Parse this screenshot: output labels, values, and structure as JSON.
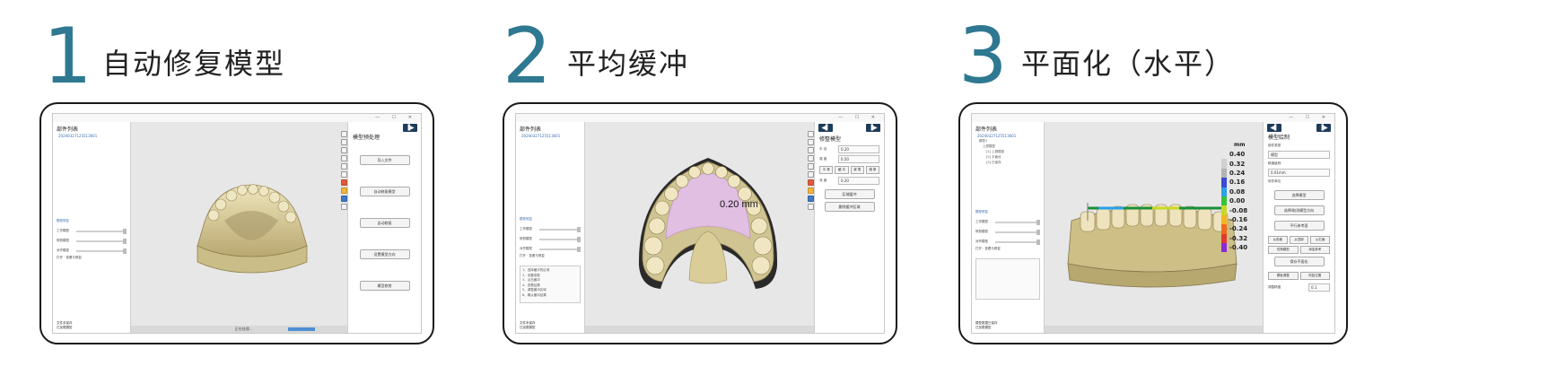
{
  "steps": [
    {
      "num": "1",
      "title": "自动修复模型"
    },
    {
      "num": "2",
      "title": "平均缓冲"
    },
    {
      "num": "3",
      "title": "平面化（水平）"
    }
  ],
  "common": {
    "window_controls": "— ☐ ✕",
    "parts_list_title": "部件列表",
    "nav_left": "◀▌",
    "nav_right": "▐▶"
  },
  "p1": {
    "file_id": "20240327125513601",
    "right_title": "模型预处理",
    "buttons": [
      "导入文件",
      "自动修复模型",
      "自动修复",
      "设置模型方向",
      "模型修剪"
    ],
    "status_text": "正在处理...",
    "foot": [
      "文件未保存",
      "已加载模型"
    ],
    "section_title": "模型修复",
    "sliders": [
      "工作模型",
      "修剪模型",
      "对齐模型"
    ],
    "section_note": "打开 · 查看与修复"
  },
  "p2": {
    "file_id": "20240327125513601",
    "right_title": "修整模型",
    "labels": [
      {
        "name": "半 径",
        "val": "0.20"
      },
      {
        "name": "强 度",
        "val": "0.50"
      }
    ],
    "seg": [
      "平 滑",
      "缓 冲",
      "减 薄",
      "增 厚"
    ],
    "depth": {
      "name": "深 度",
      "val": "0.20"
    },
    "actions": [
      "区域缓冲",
      "删除缓冲区域"
    ],
    "annotation": "0.20 mm",
    "section_title": "模型修复",
    "sliders": [
      "工作模型",
      "修剪模型",
      "对齐模型"
    ],
    "section_note": "打开 · 查看与修复",
    "notes": [
      "1、选择缓冲的区域",
      "2、设置参数",
      "3、点击缓冲",
      "4、查看结果",
      "5、调整缓冲区域",
      "6、确认缓冲结果"
    ],
    "foot": [
      "文件未保存",
      "已加载模型"
    ]
  },
  "p3": {
    "file_id": "20240327125513601",
    "tree": [
      "模型1",
      "上颌模型",
      "[1] 上颌模型",
      "[2] 平面化",
      "[3] 已保存"
    ],
    "right_title": "模型绘制",
    "labels": [
      "部件类型",
      "模型",
      "精度级别",
      "0.01mm",
      "软件单位"
    ],
    "btns": [
      "选择模型",
      "选择/取消模型方向",
      "平行参考面"
    ],
    "seg1": [
      "从前面",
      "从顶部",
      "从右面"
    ],
    "seg2": [
      "切换模型",
      "添加参考"
    ],
    "btn4": "保存平面化",
    "seg3": [
      "模板调整",
      "恢复位置"
    ],
    "final_label": "调整精度",
    "final_val": "0.1",
    "unit": "mm",
    "scale": [
      {
        "v": "0.40",
        "c": "#e8e8e8"
      },
      {
        "v": "0.32",
        "c": "#d0d0d0"
      },
      {
        "v": "0.24",
        "c": "#b3b3b3"
      },
      {
        "v": "0.16",
        "c": "#3a4bd4"
      },
      {
        "v": "0.08",
        "c": "#2aa0e8"
      },
      {
        "v": "0.00",
        "c": "#38c23a"
      },
      {
        "v": "-0.08",
        "c": "#c8d827"
      },
      {
        "v": "-0.16",
        "c": "#f2b520"
      },
      {
        "v": "-0.24",
        "c": "#ee6a1e"
      },
      {
        "v": "-0.32",
        "c": "#e23a2a"
      },
      {
        "v": "-0.40",
        "c": "#8a2bd8"
      }
    ],
    "section_title": "模型修复",
    "sliders": [
      "工作模型",
      "修剪模型",
      "对齐模型"
    ],
    "section_note": "打开 · 查看与修复",
    "foot": [
      "模型数据已保存",
      "已加载模型"
    ]
  },
  "colors": {
    "accent": "#2f7891",
    "nav": "#1f3b5c",
    "model": "#e2d7a6"
  }
}
